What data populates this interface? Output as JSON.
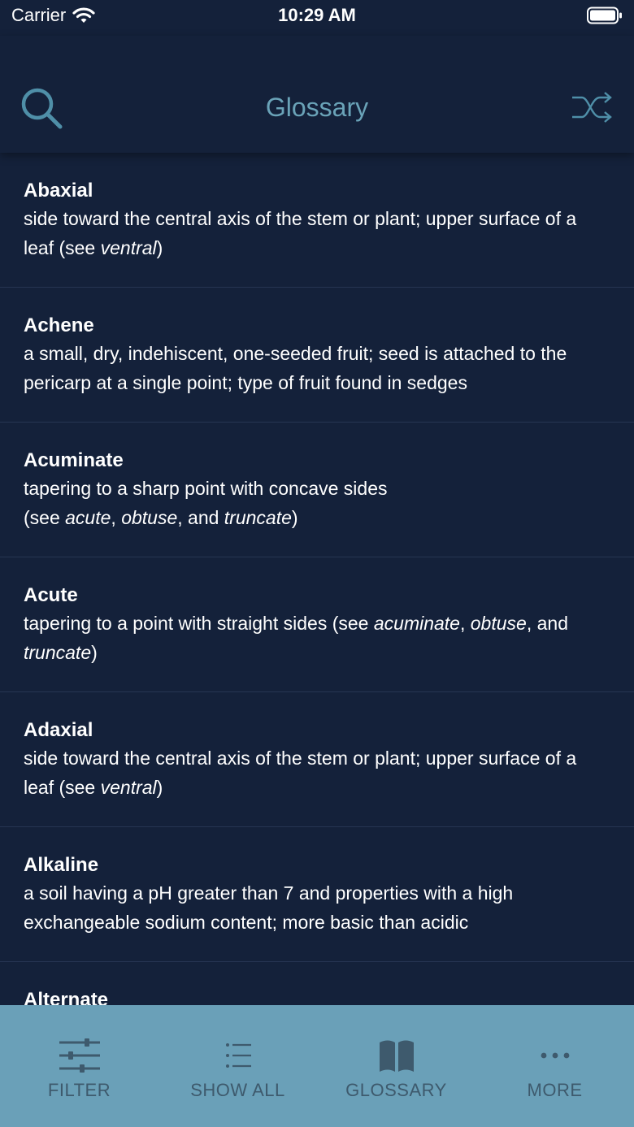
{
  "status": {
    "carrier": "Carrier",
    "time": "10:29 AM"
  },
  "nav": {
    "title": "Glossary"
  },
  "entries": [
    {
      "term": "Abaxial",
      "def": [
        {
          "t": "side toward the central axis of the stem or plant; upper surface of a leaf (see "
        },
        {
          "t": "ventral",
          "i": true
        },
        {
          "t": ")"
        }
      ]
    },
    {
      "term": "Achene",
      "def": [
        {
          "t": "a small, dry, indehiscent, one-seeded fruit; seed is attached to the pericarp at a single point; type of fruit found in sedges"
        }
      ]
    },
    {
      "term": "Acuminate",
      "def": [
        {
          "t": "tapering to a sharp point with concave sides"
        },
        {
          "br": true
        },
        {
          "t": "(see "
        },
        {
          "t": "acute",
          "i": true
        },
        {
          "t": ", "
        },
        {
          "t": "obtuse",
          "i": true
        },
        {
          "t": ", and "
        },
        {
          "t": "truncate",
          "i": true
        },
        {
          "t": ")"
        }
      ]
    },
    {
      "term": "Acute",
      "def": [
        {
          "t": "tapering to a point with straight sides (see "
        },
        {
          "t": "acuminate",
          "i": true
        },
        {
          "t": ", "
        },
        {
          "t": "obtuse",
          "i": true
        },
        {
          "t": ", and "
        },
        {
          "t": "truncate",
          "i": true
        },
        {
          "t": ")"
        }
      ]
    },
    {
      "term": "Adaxial",
      "def": [
        {
          "t": "side toward the central axis of the stem or plant; upper surface of a leaf (see "
        },
        {
          "t": "ventral",
          "i": true
        },
        {
          "t": ")"
        }
      ]
    },
    {
      "term": "Alkaline",
      "def": [
        {
          "t": "a soil having a pH greater than 7 and properties with a high exchangeable sodium content; more basic than acidic"
        }
      ]
    },
    {
      "term": "Alternate",
      "def": []
    }
  ],
  "tabs": [
    {
      "label": "FILTER",
      "icon": "sliders-icon"
    },
    {
      "label": "SHOW ALL",
      "icon": "list-icon"
    },
    {
      "label": "GLOSSARY",
      "icon": "book-icon"
    },
    {
      "label": "MORE",
      "icon": "ellipsis-icon"
    }
  ],
  "colors": {
    "background": "#14213a",
    "accent": "#6aa3b8",
    "tabbar": "#6aa0b8",
    "tab_label": "#3e5a6d",
    "divider": "#263552"
  }
}
